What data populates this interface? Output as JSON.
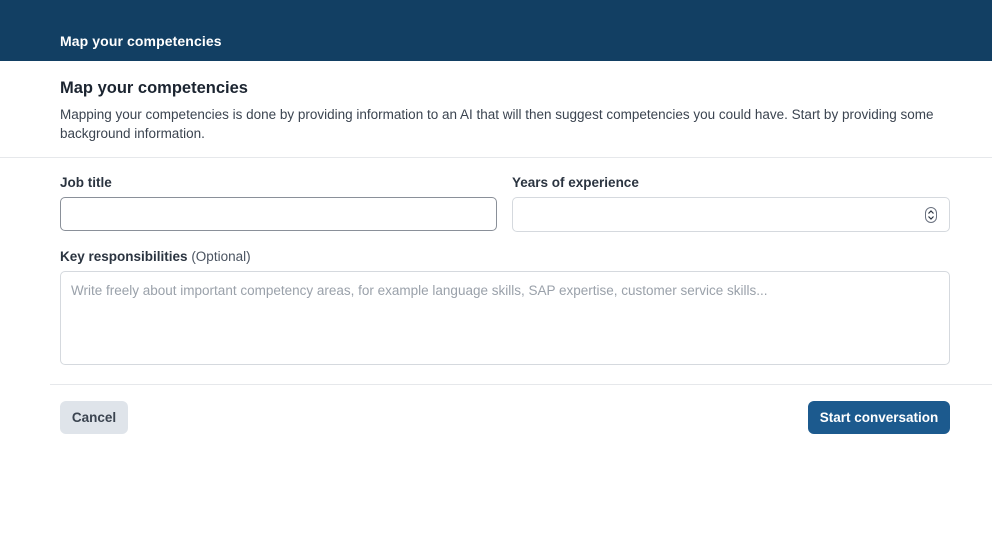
{
  "topbar": {
    "title": "Map your competencies"
  },
  "dialog": {
    "title": "Map your competencies",
    "description": "Mapping your competencies is done by providing information to an AI that will then suggest competencies you could have. Start by providing some background information."
  },
  "form": {
    "job_title": {
      "label": "Job title",
      "value": ""
    },
    "years_experience": {
      "label": "Years of experience",
      "value": ""
    },
    "key_responsibilities": {
      "label": "Key responsibilities",
      "optional_label": "(Optional)",
      "placeholder": "Write freely about important competency areas, for example language skills, SAP expertise, customer service skills...",
      "value": ""
    }
  },
  "actions": {
    "cancel_label": "Cancel",
    "start_label": "Start conversation"
  },
  "colors": {
    "topbar": "#123f63",
    "primary_button": "#1c5a8e",
    "secondary_button": "#dfe4ea"
  }
}
